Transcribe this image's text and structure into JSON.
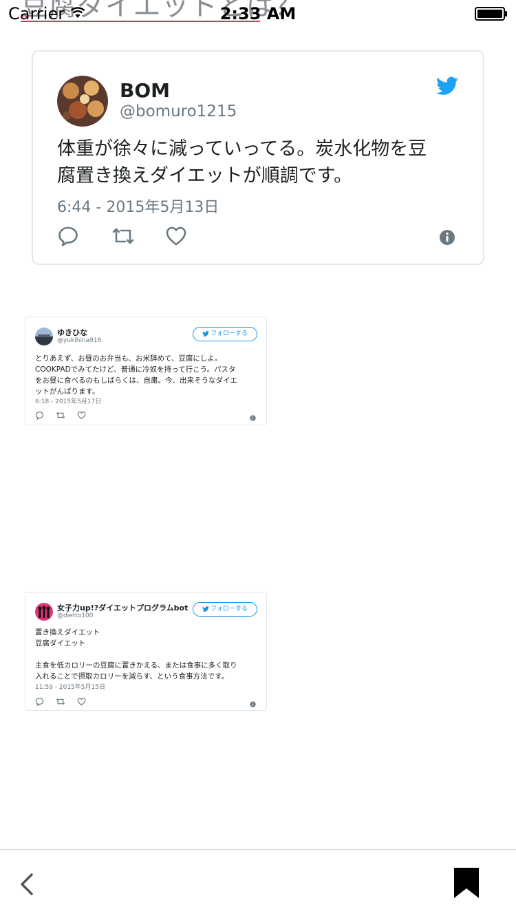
{
  "page": {
    "heading": "豆腐ダイエットとは？"
  },
  "status_bar": {
    "carrier": "Carrier",
    "time": "2:33 AM"
  },
  "main_tweet": {
    "name": "BOM",
    "handle": "@bomuro1215",
    "text_line1": "体重が徐々に減っていってる。炭水化物を豆",
    "text_line2": "腐置き換えダイエットが順調です。",
    "date": "6:44 - 2015年5月13日",
    "accent_color": "#1da1f2"
  },
  "embedded_tweets": [
    {
      "name": "ゆきひな",
      "handle": "@yukihina916",
      "follow_label": "フォローする",
      "lines": [
        "とりあえず、お昼のお弁当も、お米辞めて、豆腐にしよ。",
        "COOKPADでみてたけど、普通に冷奴を持って行こう。パスタ",
        "をお昼に食べるのもしばらくは、自粛。今、出来そうなダイエ",
        "ットがんばります。"
      ],
      "date": "6:18 - 2015年5月17日"
    },
    {
      "name": "女子力up!?ダイエットプログラムbot",
      "handle": "@dietto100",
      "follow_label": "フォローする",
      "lines": [
        "置き換えダイエット",
        "豆腐ダイエット",
        "",
        "主食を低カロリーの豆腐に置きかえる、または食事に多く取り",
        "入れることで摂取カロリーを減らす、という食事方法です。"
      ],
      "date": "11:59 - 2015年5月15日"
    }
  ],
  "toolbar": {
    "back_icon": "chevron-left-icon",
    "bookmark_icon": "bookmark-icon"
  }
}
